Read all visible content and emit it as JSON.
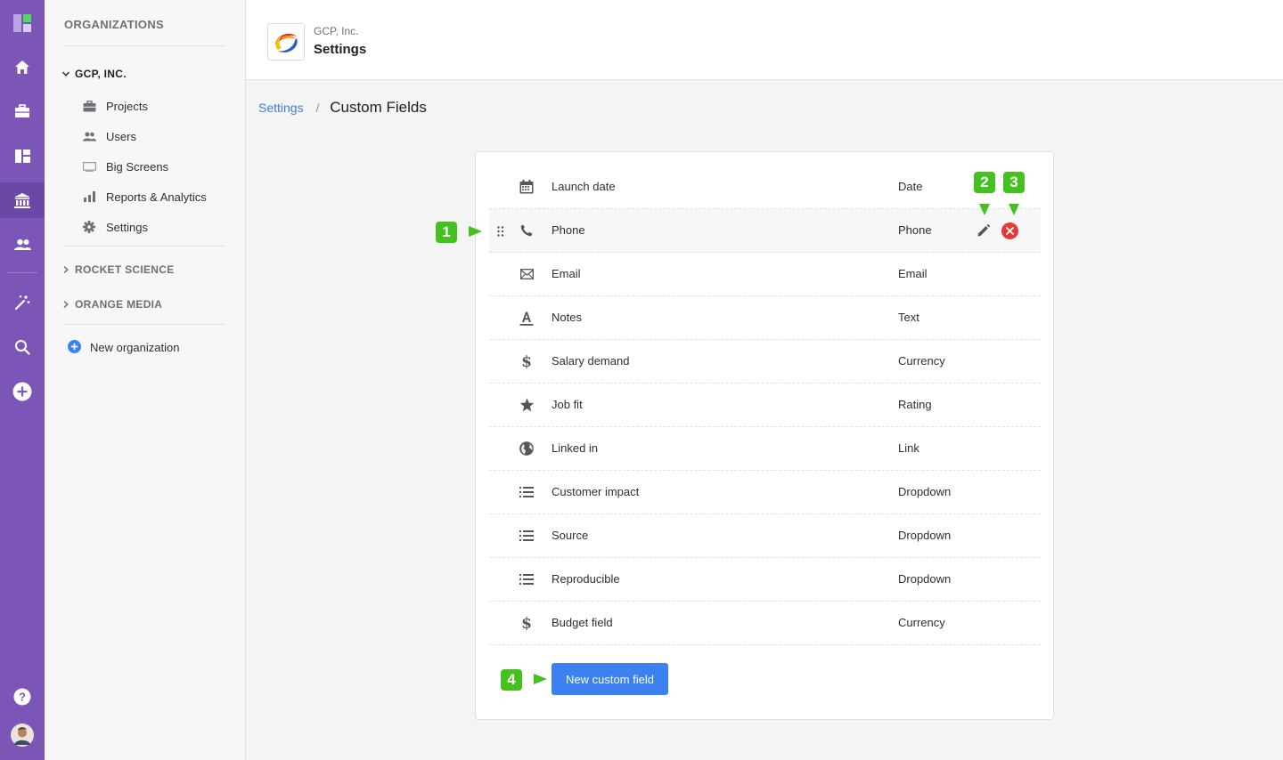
{
  "rail": {
    "icons": [
      "logo-icon",
      "home-icon",
      "briefcase-icon",
      "dashboard-icon",
      "bank-icon",
      "users-icon",
      "magic-wand-icon",
      "search-icon",
      "add-icon",
      "help-icon",
      "avatar"
    ]
  },
  "sidebar": {
    "title": "ORGANIZATIONS",
    "orgs": [
      {
        "name": "GCP, INC.",
        "expanded": true
      },
      {
        "name": "ROCKET SCIENCE",
        "expanded": false
      },
      {
        "name": "ORANGE MEDIA",
        "expanded": false
      }
    ],
    "items": [
      {
        "label": "Projects",
        "icon": "briefcase-icon"
      },
      {
        "label": "Users",
        "icon": "users-icon"
      },
      {
        "label": "Big Screens",
        "icon": "screen-icon"
      },
      {
        "label": "Reports & Analytics",
        "icon": "bar-chart-icon"
      },
      {
        "label": "Settings",
        "icon": "gear-icon"
      }
    ],
    "new_org_label": "New organization"
  },
  "header": {
    "org_name": "GCP, Inc.",
    "title": "Settings"
  },
  "breadcrumb": {
    "parent": "Settings",
    "separator": "/",
    "current": "Custom Fields"
  },
  "fields": [
    {
      "name": "Launch date",
      "type": "Date",
      "icon": "calendar-icon"
    },
    {
      "name": "Phone",
      "type": "Phone",
      "icon": "phone-icon"
    },
    {
      "name": "Email",
      "type": "Email",
      "icon": "envelope-icon"
    },
    {
      "name": "Notes",
      "type": "Text",
      "icon": "text-icon"
    },
    {
      "name": "Salary demand",
      "type": "Currency",
      "icon": "dollar-icon"
    },
    {
      "name": "Job fit",
      "type": "Rating",
      "icon": "star-icon"
    },
    {
      "name": "Linked in",
      "type": "Link",
      "icon": "globe-icon"
    },
    {
      "name": "Customer impact",
      "type": "Dropdown",
      "icon": "list-icon"
    },
    {
      "name": "Source",
      "type": "Dropdown",
      "icon": "list-icon"
    },
    {
      "name": "Reproducible",
      "type": "Dropdown",
      "icon": "list-icon"
    },
    {
      "name": "Budget field",
      "type": "Currency",
      "icon": "dollar-icon"
    }
  ],
  "new_field_button": "New custom field",
  "callouts": [
    "1",
    "2",
    "3",
    "4"
  ],
  "colors": {
    "rail": "#7b56b7",
    "primary_button": "#3b82f0",
    "link": "#3b7ed6",
    "delete": "#e53935",
    "callout": "#44c01f"
  }
}
